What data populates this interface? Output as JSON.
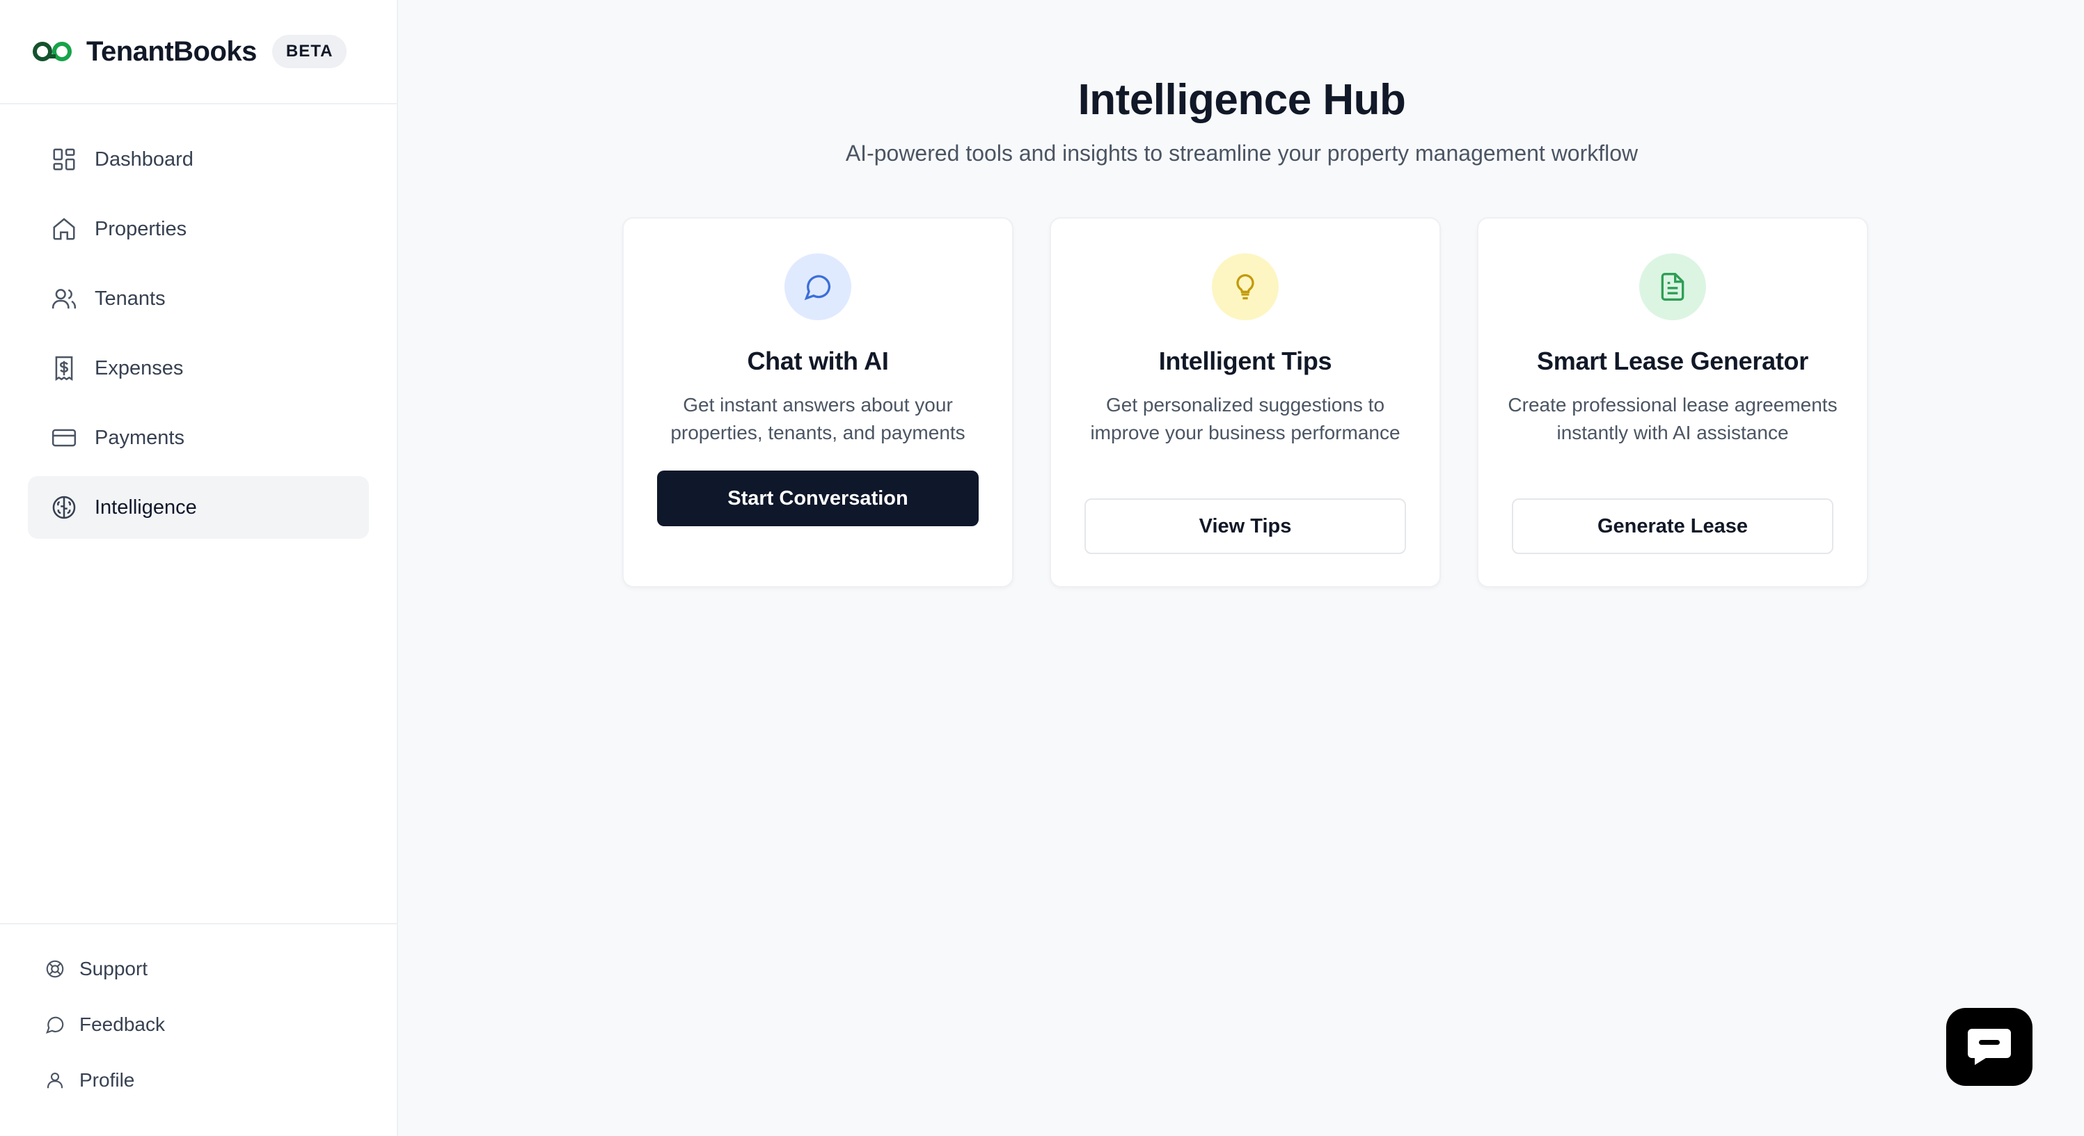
{
  "brand": {
    "name": "TenantBooks",
    "badge": "BETA",
    "accent": "#2e8b57"
  },
  "sidebar": {
    "items": [
      {
        "label": "Dashboard",
        "icon": "dashboard-icon",
        "active": false
      },
      {
        "label": "Properties",
        "icon": "home-icon",
        "active": false
      },
      {
        "label": "Tenants",
        "icon": "users-icon",
        "active": false
      },
      {
        "label": "Expenses",
        "icon": "receipt-dollar-icon",
        "active": false
      },
      {
        "label": "Payments",
        "icon": "credit-card-icon",
        "active": false
      },
      {
        "label": "Intelligence",
        "icon": "brain-icon",
        "active": true
      }
    ],
    "bottom": [
      {
        "label": "Support",
        "icon": "lifebuoy-icon"
      },
      {
        "label": "Feedback",
        "icon": "message-circle-icon"
      },
      {
        "label": "Profile",
        "icon": "user-icon"
      }
    ]
  },
  "main": {
    "title": "Intelligence Hub",
    "subtitle": "AI-powered tools and insights to streamline your property management workflow",
    "cards": [
      {
        "title": "Chat with AI",
        "description": "Get instant answers about your properties, tenants, and payments",
        "button": "Start Conversation",
        "icon": "message-circle-icon",
        "icon_bg": "#e0eaff",
        "icon_color": "#3b6fd8"
      },
      {
        "title": "Intelligent Tips",
        "description": "Get personalized suggestions to improve your business performance",
        "button": "View Tips",
        "icon": "lightbulb-icon",
        "icon_bg": "#fdf6c3",
        "icon_color": "#c49a0b"
      },
      {
        "title": "Smart Lease Generator",
        "description": "Create professional lease agreements instantly with AI assistance",
        "button": "Generate Lease",
        "icon": "file-text-icon",
        "icon_bg": "#dcf5e3",
        "icon_color": "#2f9e55"
      }
    ]
  },
  "chat_widget": {
    "icon": "chat-bubble-icon"
  }
}
